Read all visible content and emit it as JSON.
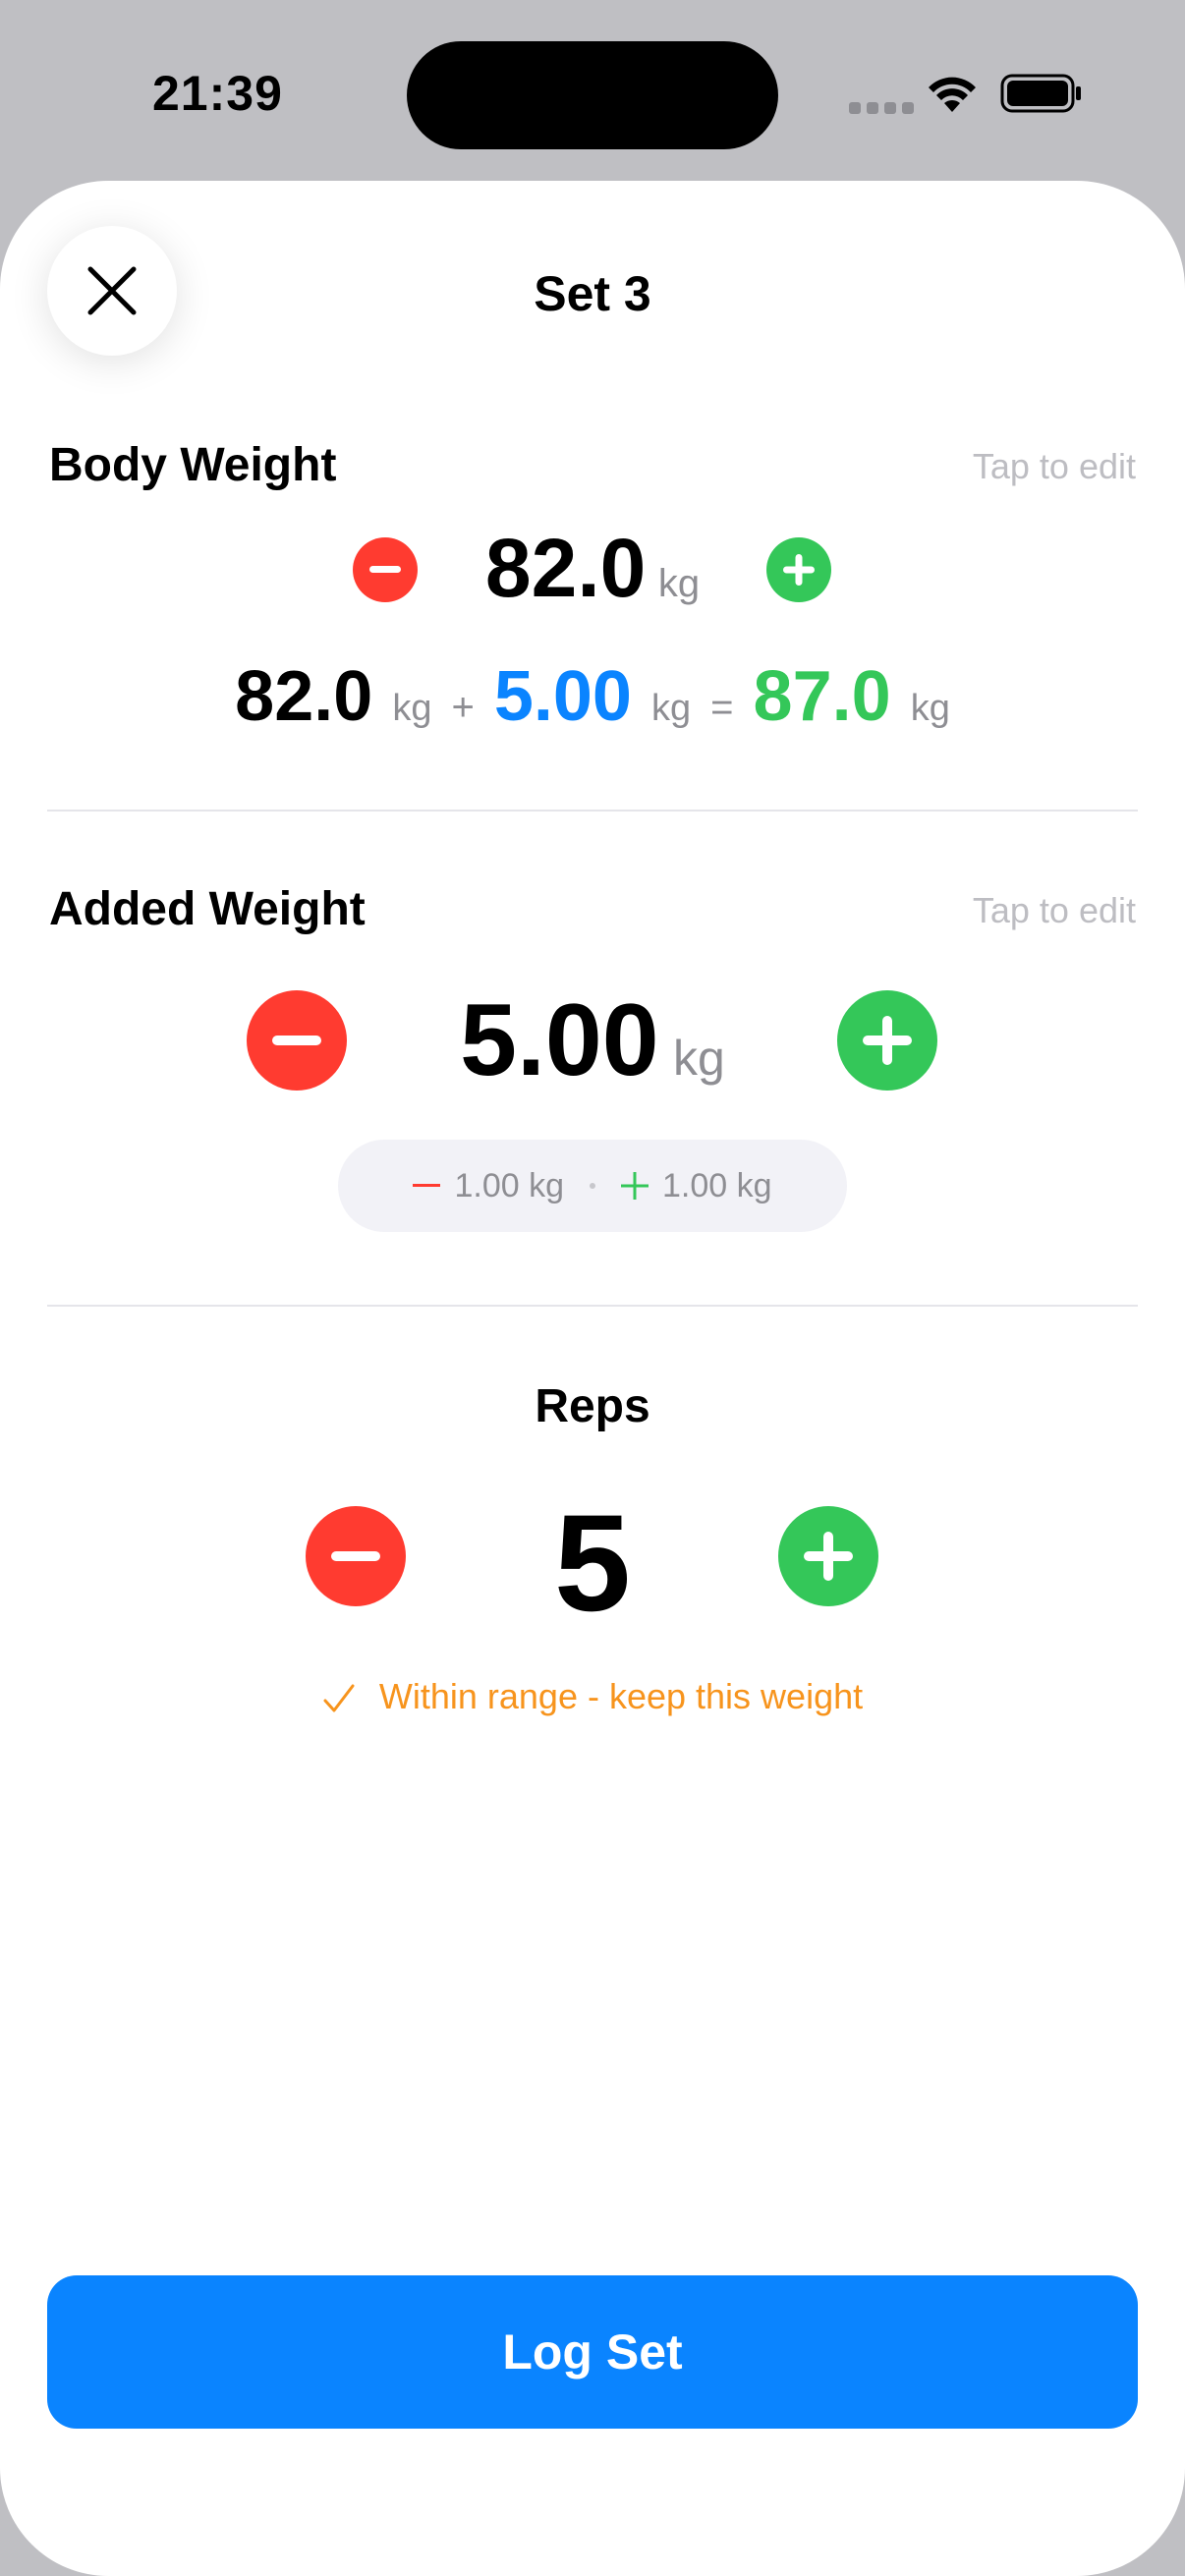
{
  "status_bar": {
    "time": "21:39"
  },
  "header": {
    "title": "Set 3"
  },
  "body_weight": {
    "label": "Body Weight",
    "tap_hint": "Tap to edit",
    "value": "82.0",
    "unit": "kg"
  },
  "formula": {
    "body": "82.0",
    "body_unit": "kg",
    "plus": "+",
    "added": "5.00",
    "added_unit": "kg",
    "equals": "=",
    "total": "87.0",
    "total_unit": "kg"
  },
  "added_weight": {
    "label": "Added Weight",
    "tap_hint": "Tap to edit",
    "value": "5.00",
    "unit": "kg",
    "step_minus": "1.00 kg",
    "step_plus": "1.00 kg"
  },
  "reps": {
    "label": "Reps",
    "value": "5",
    "hint": "Within range - keep this weight"
  },
  "actions": {
    "log_label": "Log Set"
  },
  "colors": {
    "accent": "#0a84ff",
    "minus": "#ff3b30",
    "plus": "#34c759",
    "hint": "#f7941d"
  }
}
